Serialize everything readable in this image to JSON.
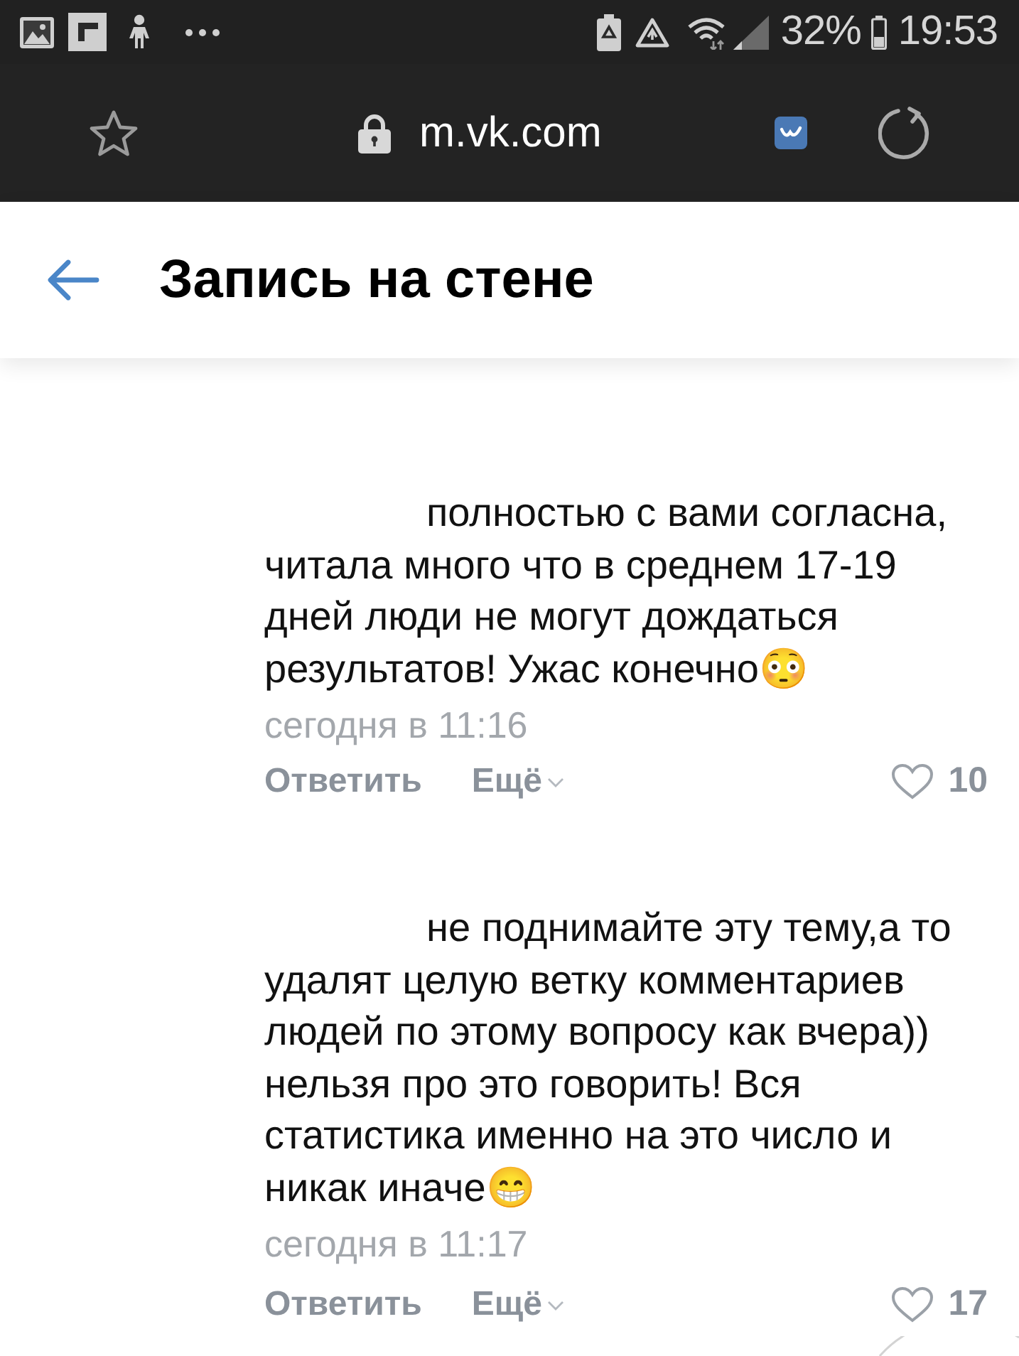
{
  "status_bar": {
    "battery": "32%",
    "time": "19:53"
  },
  "browser_bar": {
    "url": "m.vk.com"
  },
  "header": {
    "title": "Запись на стене"
  },
  "comments": [
    {
      "text": "полностью с вами согласна, читала много что в среднем 17-19 дней люди не могут дождаться результатов! Ужас конечно😳",
      "time": "сегодня в 11:16",
      "reply": "Ответить",
      "more": "Ещё",
      "likes": "10",
      "liked": false
    },
    {
      "text": "не поднимайте эту тему,а то удалят целую ветку комментариев людей по этому вопросу как вчера)) нельзя про это говорить! Вся статистика именно на это число и никак иначе😁",
      "time": "сегодня в 11:17",
      "reply": "Ответить",
      "more": "Ещё",
      "likes": "17",
      "liked": false
    }
  ]
}
